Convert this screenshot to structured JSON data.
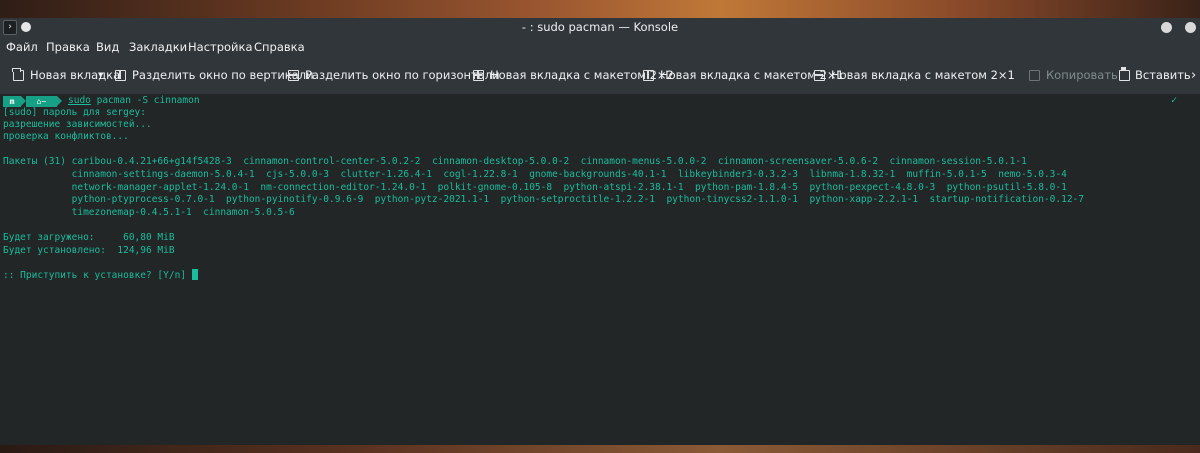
{
  "titlebar": {
    "app_icon": "terminal-app-icon",
    "title": "- : sudo pacman — Konsole"
  },
  "menu": [
    "Файл",
    "Правка",
    "Вид",
    "Закладки",
    "Настройка",
    "Справка"
  ],
  "toolbar": {
    "new_tab": "Новая вкладка",
    "split_vertical": "Разделить окно по вертикали",
    "split_horizontal": "Разделить окно по горизонтали",
    "layout_2x2": "Новая вкладка с макетом 2×2",
    "layout_2x1_a": "Новая вкладка с макетом 2×1",
    "layout_2x1_b": "Новая вкладка с макетом 2×1",
    "copy": "Копировать",
    "paste": "Вставить",
    "more": "›"
  },
  "terminal": {
    "prompt_os": "m",
    "prompt_home": "~",
    "cmd_sudo": "sudo",
    "cmd_rest": " pacman -S cinnamon",
    "status_check": "✓",
    "lines": [
      "[sudo] пароль для sergey:",
      "разрешение зависимостей...",
      "проверка конфликтов...",
      "",
      "Пакеты (31) caribou-0.4.21+66+g14f5428-3  cinnamon-control-center-5.0.2-2  cinnamon-desktop-5.0.0-2  cinnamon-menus-5.0.0-2  cinnamon-screensaver-5.0.6-2  cinnamon-session-5.0.1-1",
      "            cinnamon-settings-daemon-5.0.4-1  cjs-5.0.0-3  clutter-1.26.4-1  cogl-1.22.8-1  gnome-backgrounds-40.1-1  libkeybinder3-0.3.2-3  libnma-1.8.32-1  muffin-5.0.1-5  nemo-5.0.3-4",
      "            network-manager-applet-1.24.0-1  nm-connection-editor-1.24.0-1  polkit-gnome-0.105-8  python-atspi-2.38.1-1  python-pam-1.8.4-5  python-pexpect-4.8.0-3  python-psutil-5.8.0-1",
      "            python-ptyprocess-0.7.0-1  python-pyinotify-0.9.6-9  python-pytz-2021.1-1  python-setproctitle-1.2.2-1  python-tinycss2-1.1.0-1  python-xapp-2.2.1-1  startup-notification-0.12-7",
      "            timezonemap-0.4.5.1-1  cinnamon-5.0.5-6",
      "",
      "Будет загружено:     60,80 MiB",
      "Будет установлено:  124,96 MiB",
      "",
      ":: Приступить к установке? [Y/n] "
    ]
  }
}
